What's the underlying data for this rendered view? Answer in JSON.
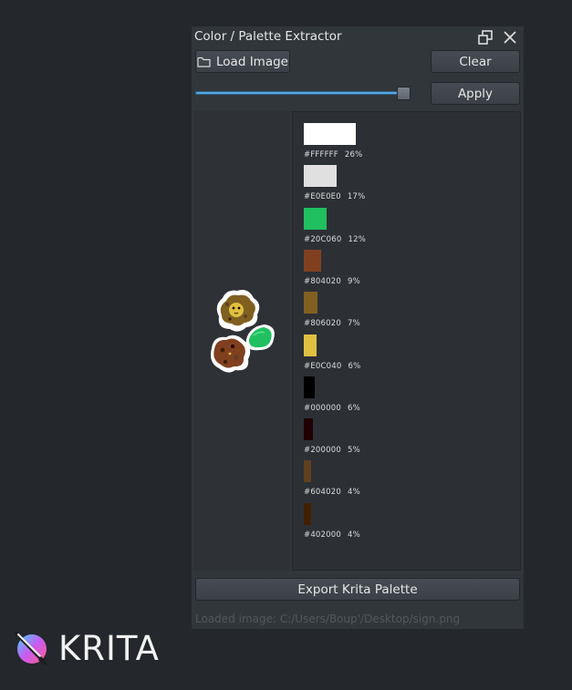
{
  "docker": {
    "title": "Color / Palette Extractor",
    "icons": {
      "float": "float-window-icon",
      "close": "close-icon"
    },
    "load_label": "Load Image",
    "load_icon": "folder-icon",
    "clear_label": "Clear",
    "apply_label": "Apply",
    "slider_value_fraction": 0.95,
    "export_label": "Export Krita Palette",
    "status": "Loaded image: C:/Users/Boup'/Desktop/sign.png"
  },
  "palette": [
    {
      "hex": "#FFFFFF",
      "percent": "26%",
      "color": "#FFFFFF"
    },
    {
      "hex": "#E0E0E0",
      "percent": "17%",
      "color": "#E0E0E0"
    },
    {
      "hex": "#20C060",
      "percent": "12%",
      "color": "#20C060"
    },
    {
      "hex": "#804020",
      "percent": "9%",
      "color": "#804020"
    },
    {
      "hex": "#806020",
      "percent": "7%",
      "color": "#806020"
    },
    {
      "hex": "#E0C040",
      "percent": "6%",
      "color": "#E0C040"
    },
    {
      "hex": "#000000",
      "percent": "6%",
      "color": "#000000"
    },
    {
      "hex": "#200000",
      "percent": "5%",
      "color": "#200000"
    },
    {
      "hex": "#604020",
      "percent": "4%",
      "color": "#604020"
    },
    {
      "hex": "#402000",
      "percent": "4%",
      "color": "#402000"
    }
  ],
  "branding": {
    "app_name": "KRITA",
    "logo_icon": "krita-logo-icon"
  }
}
